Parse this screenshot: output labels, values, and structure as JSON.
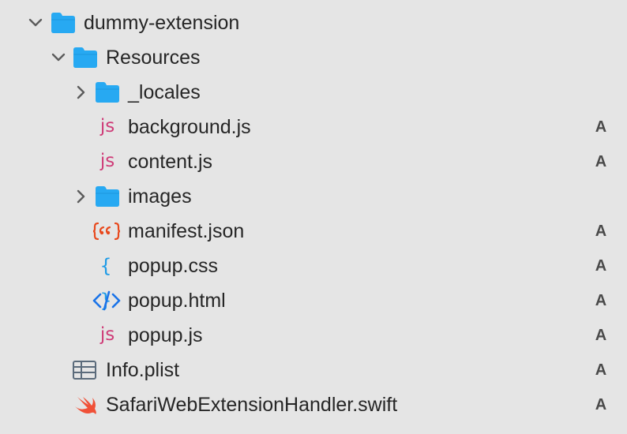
{
  "tree": {
    "root": {
      "label": "dummy-extension",
      "expanded": true
    },
    "resources": {
      "label": "Resources",
      "expanded": true
    },
    "locales": {
      "label": "_locales",
      "expanded": false
    },
    "background": {
      "label": "background.js",
      "status": "A",
      "icon_text": "js"
    },
    "content": {
      "label": "content.js",
      "status": "A",
      "icon_text": "js"
    },
    "images": {
      "label": "images",
      "expanded": false
    },
    "manifest": {
      "label": "manifest.json",
      "status": "A"
    },
    "popup_css": {
      "label": "popup.css",
      "status": "A",
      "icon_text": "{ }"
    },
    "popup_html": {
      "label": "popup.html",
      "status": "A"
    },
    "popup_js": {
      "label": "popup.js",
      "status": "A",
      "icon_text": "js"
    },
    "info_plist": {
      "label": "Info.plist",
      "status": "A"
    },
    "handler": {
      "label": "SafariWebExtensionHandler.swift",
      "status": "A"
    }
  },
  "colors": {
    "folder": "#27a9f2",
    "js": "#cf3c78",
    "json": "#e8491d",
    "css": "#1e9be6",
    "html": "#1a73e8",
    "swift": "#f05138",
    "plist": "#5b6b7b"
  }
}
